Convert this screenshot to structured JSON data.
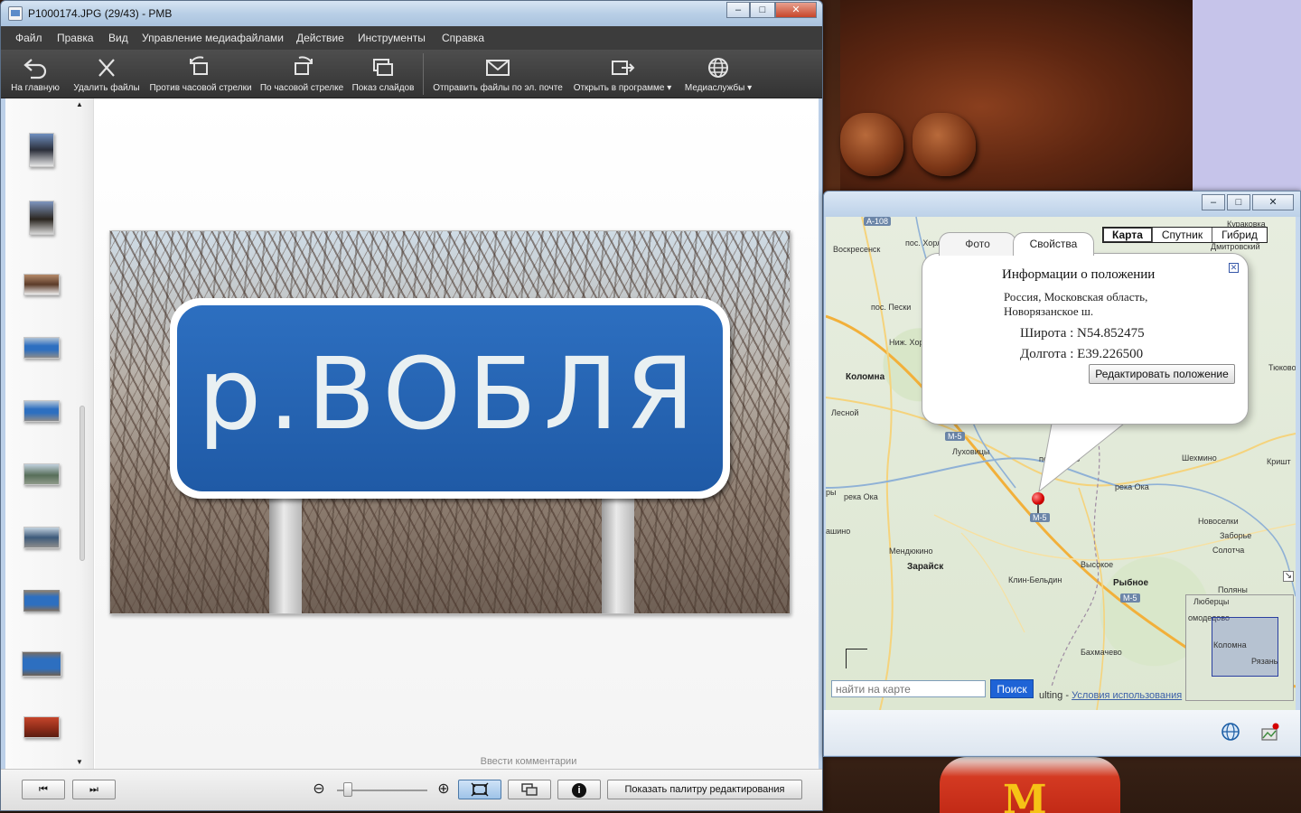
{
  "pmb": {
    "title": "P1000174.JPG (29/43)  - PMB",
    "window_buttons": {
      "minimize": "–",
      "maximize": "□",
      "close": "✕"
    },
    "menu": [
      "Файл",
      "Правка",
      "Вид",
      "Управление медиафайлами",
      "Действие",
      "Инструменты",
      "Справка"
    ],
    "toolbar": [
      {
        "label": "На главную",
        "icon": "back-arrow-icon"
      },
      {
        "label": "Удалить файлы",
        "icon": "delete-x-icon"
      },
      {
        "label": "Против часовой стрелки",
        "icon": "rotate-ccw-icon"
      },
      {
        "label": "По часовой стрелке",
        "icon": "rotate-cw-icon"
      },
      {
        "label": "Показ слайдов",
        "icon": "slideshow-icon"
      },
      {
        "label": "Отправить файлы по эл. почте",
        "icon": "mail-icon"
      },
      {
        "label": "Открыть в программе",
        "icon": "open-with-icon"
      },
      {
        "label": "Медиаслужбы",
        "icon": "globe-icon"
      }
    ],
    "photo_sign_text": "р.ВОБЛЯ",
    "comment_placeholder": "Ввести комментарии",
    "bottom": {
      "prev_icon": "⏮",
      "next_icon": "⏭",
      "zoom_out_icon": "⊖",
      "zoom_in_icon": "⊕",
      "info_icon": "i",
      "palette_button": "Показать палитру редактирования",
      "zoom_level": 0.08
    }
  },
  "map": {
    "window_buttons": {
      "minimize": "–",
      "maximize": "□",
      "close": "✕"
    },
    "map_types": [
      "Карта",
      "Спутник",
      "Гибрид"
    ],
    "active_map_type": "Карта",
    "balloon": {
      "tabs": [
        "Фото",
        "Свойства"
      ],
      "active_tab": "Свойства",
      "title": "Информации о положении",
      "address_line1": "Россия, Московская область,",
      "address_line2": "Новорязанское ш.",
      "latitude": "Широта : N54.852475",
      "longitude": "Долгота : E39.226500",
      "edit_button": "Редактировать положение",
      "close_icon": "✕"
    },
    "towns": {
      "voskresensk": "Воскресенск",
      "khorlovo": "пос. Хорлов",
      "peski": "пос. Пески",
      "nizh_khoroshovo": "Ниж. Хорошово",
      "kolomna": "Коломна",
      "lesnoy": "Лесной",
      "lukhovitsy": "Луховицы",
      "reka_oka_left": "река Ока",
      "reka_oka_right": "река Ока",
      "zaraisk": "Зарайск",
      "mendyukino": "Мендюкино",
      "klin_beldin": "Клин-Бельдин",
      "vysokoe": "Высокое",
      "rybnoe": "Рыбное",
      "bakhmachevo": "Бахмачево",
      "shekhmino": "Шехмино",
      "novoselki": "Новоселки",
      "zaborye": "Заборье",
      "solotcha": "Солотча",
      "polyany": "Поляны",
      "tyukovo": "Тюково",
      "kurakovka": "Кураковка",
      "dmitrovskiy": "Дмитровский",
      "krishtos": "Кришт",
      "kalinovo": "ашино",
      "kamenka": "ры",
      "beloomut": "пос. Белоо",
      "a108": "А-108",
      "m5a": "М-5",
      "m5b": "М-5",
      "m5c": "М-5"
    },
    "overview": {
      "lyubertsy": "Люберцы",
      "domodedovo": "омодедово",
      "kolomna": "Коломна",
      "ryazan": "Рязань"
    },
    "search_placeholder": "найти на карте",
    "search_button": "Поиск",
    "credit": "ulting -",
    "terms_link": "Условия использования",
    "bottom_icons": [
      "globe-icon",
      "map-pin-icon"
    ]
  }
}
